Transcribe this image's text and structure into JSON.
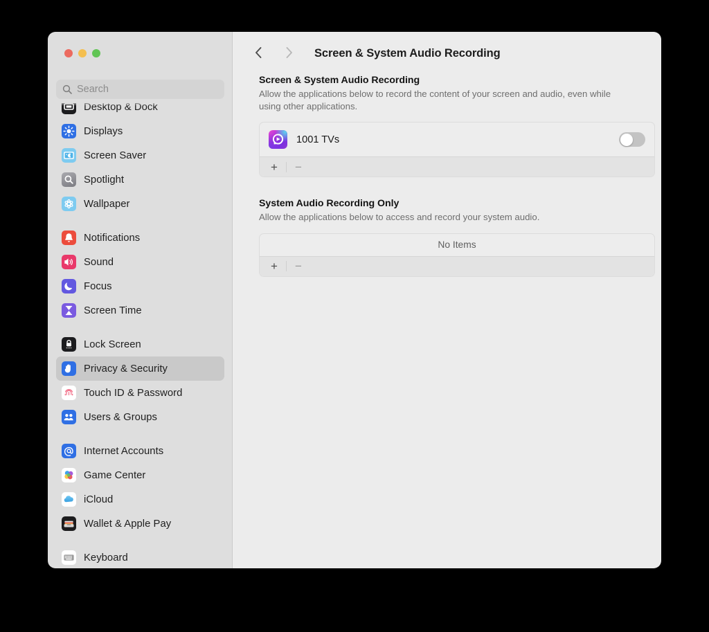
{
  "window": {
    "traffic_lights": [
      "close",
      "minimize",
      "maximize"
    ],
    "title": "Screen & System Audio Recording"
  },
  "sidebar": {
    "search": {
      "placeholder": "Search",
      "value": ""
    },
    "groups": [
      {
        "items": [
          {
            "label": "Desktop & Dock",
            "icon": "desktop-dock-icon",
            "selected": false,
            "clipped": true
          },
          {
            "label": "Displays",
            "icon": "displays-icon",
            "selected": false
          },
          {
            "label": "Screen Saver",
            "icon": "screen-saver-icon",
            "selected": false
          },
          {
            "label": "Spotlight",
            "icon": "spotlight-icon",
            "selected": false
          },
          {
            "label": "Wallpaper",
            "icon": "wallpaper-icon",
            "selected": false
          }
        ]
      },
      {
        "items": [
          {
            "label": "Notifications",
            "icon": "notifications-icon",
            "selected": false
          },
          {
            "label": "Sound",
            "icon": "sound-icon",
            "selected": false
          },
          {
            "label": "Focus",
            "icon": "focus-icon",
            "selected": false
          },
          {
            "label": "Screen Time",
            "icon": "screen-time-icon",
            "selected": false
          }
        ]
      },
      {
        "items": [
          {
            "label": "Lock Screen",
            "icon": "lock-screen-icon",
            "selected": false
          },
          {
            "label": "Privacy & Security",
            "icon": "privacy-security-icon",
            "selected": true
          },
          {
            "label": "Touch ID & Password",
            "icon": "touch-id-icon",
            "selected": false
          },
          {
            "label": "Users & Groups",
            "icon": "users-groups-icon",
            "selected": false
          }
        ]
      },
      {
        "items": [
          {
            "label": "Internet Accounts",
            "icon": "internet-accounts-icon",
            "selected": false
          },
          {
            "label": "Game Center",
            "icon": "game-center-icon",
            "selected": false
          },
          {
            "label": "iCloud",
            "icon": "icloud-icon",
            "selected": false
          },
          {
            "label": "Wallet & Apple Pay",
            "icon": "wallet-apple-pay-icon",
            "selected": false
          }
        ]
      },
      {
        "items": [
          {
            "label": "Keyboard",
            "icon": "keyboard-icon",
            "selected": false
          }
        ]
      }
    ]
  },
  "toolbar": {
    "back_icon": "chevron-left-icon",
    "forward_icon": "chevron-right-icon",
    "back_enabled": true,
    "forward_enabled": false,
    "title": "Screen & System Audio Recording"
  },
  "sections": [
    {
      "title": "Screen & System Audio Recording",
      "description": "Allow the applications below to record the content of your screen and audio, even while using other applications.",
      "apps": [
        {
          "name": "1001 TVs",
          "icon": "1001-tvs-app-icon",
          "enabled": false
        }
      ],
      "empty_text": null,
      "add_label": "+",
      "remove_label": "−"
    },
    {
      "title": "System Audio Recording Only",
      "description": "Allow the applications below to access and record your system audio.",
      "apps": [],
      "empty_text": "No Items",
      "add_label": "+",
      "remove_label": "−"
    }
  ],
  "colors": {
    "window_bg": "#ececec",
    "sidebar_bg": "#dedede",
    "selection": "#c9c9c9",
    "accent": "#3478f6",
    "toggle_off": "#c3c3c3",
    "text_primary": "#1d1d1d",
    "text_secondary": "#6e6e6e"
  }
}
